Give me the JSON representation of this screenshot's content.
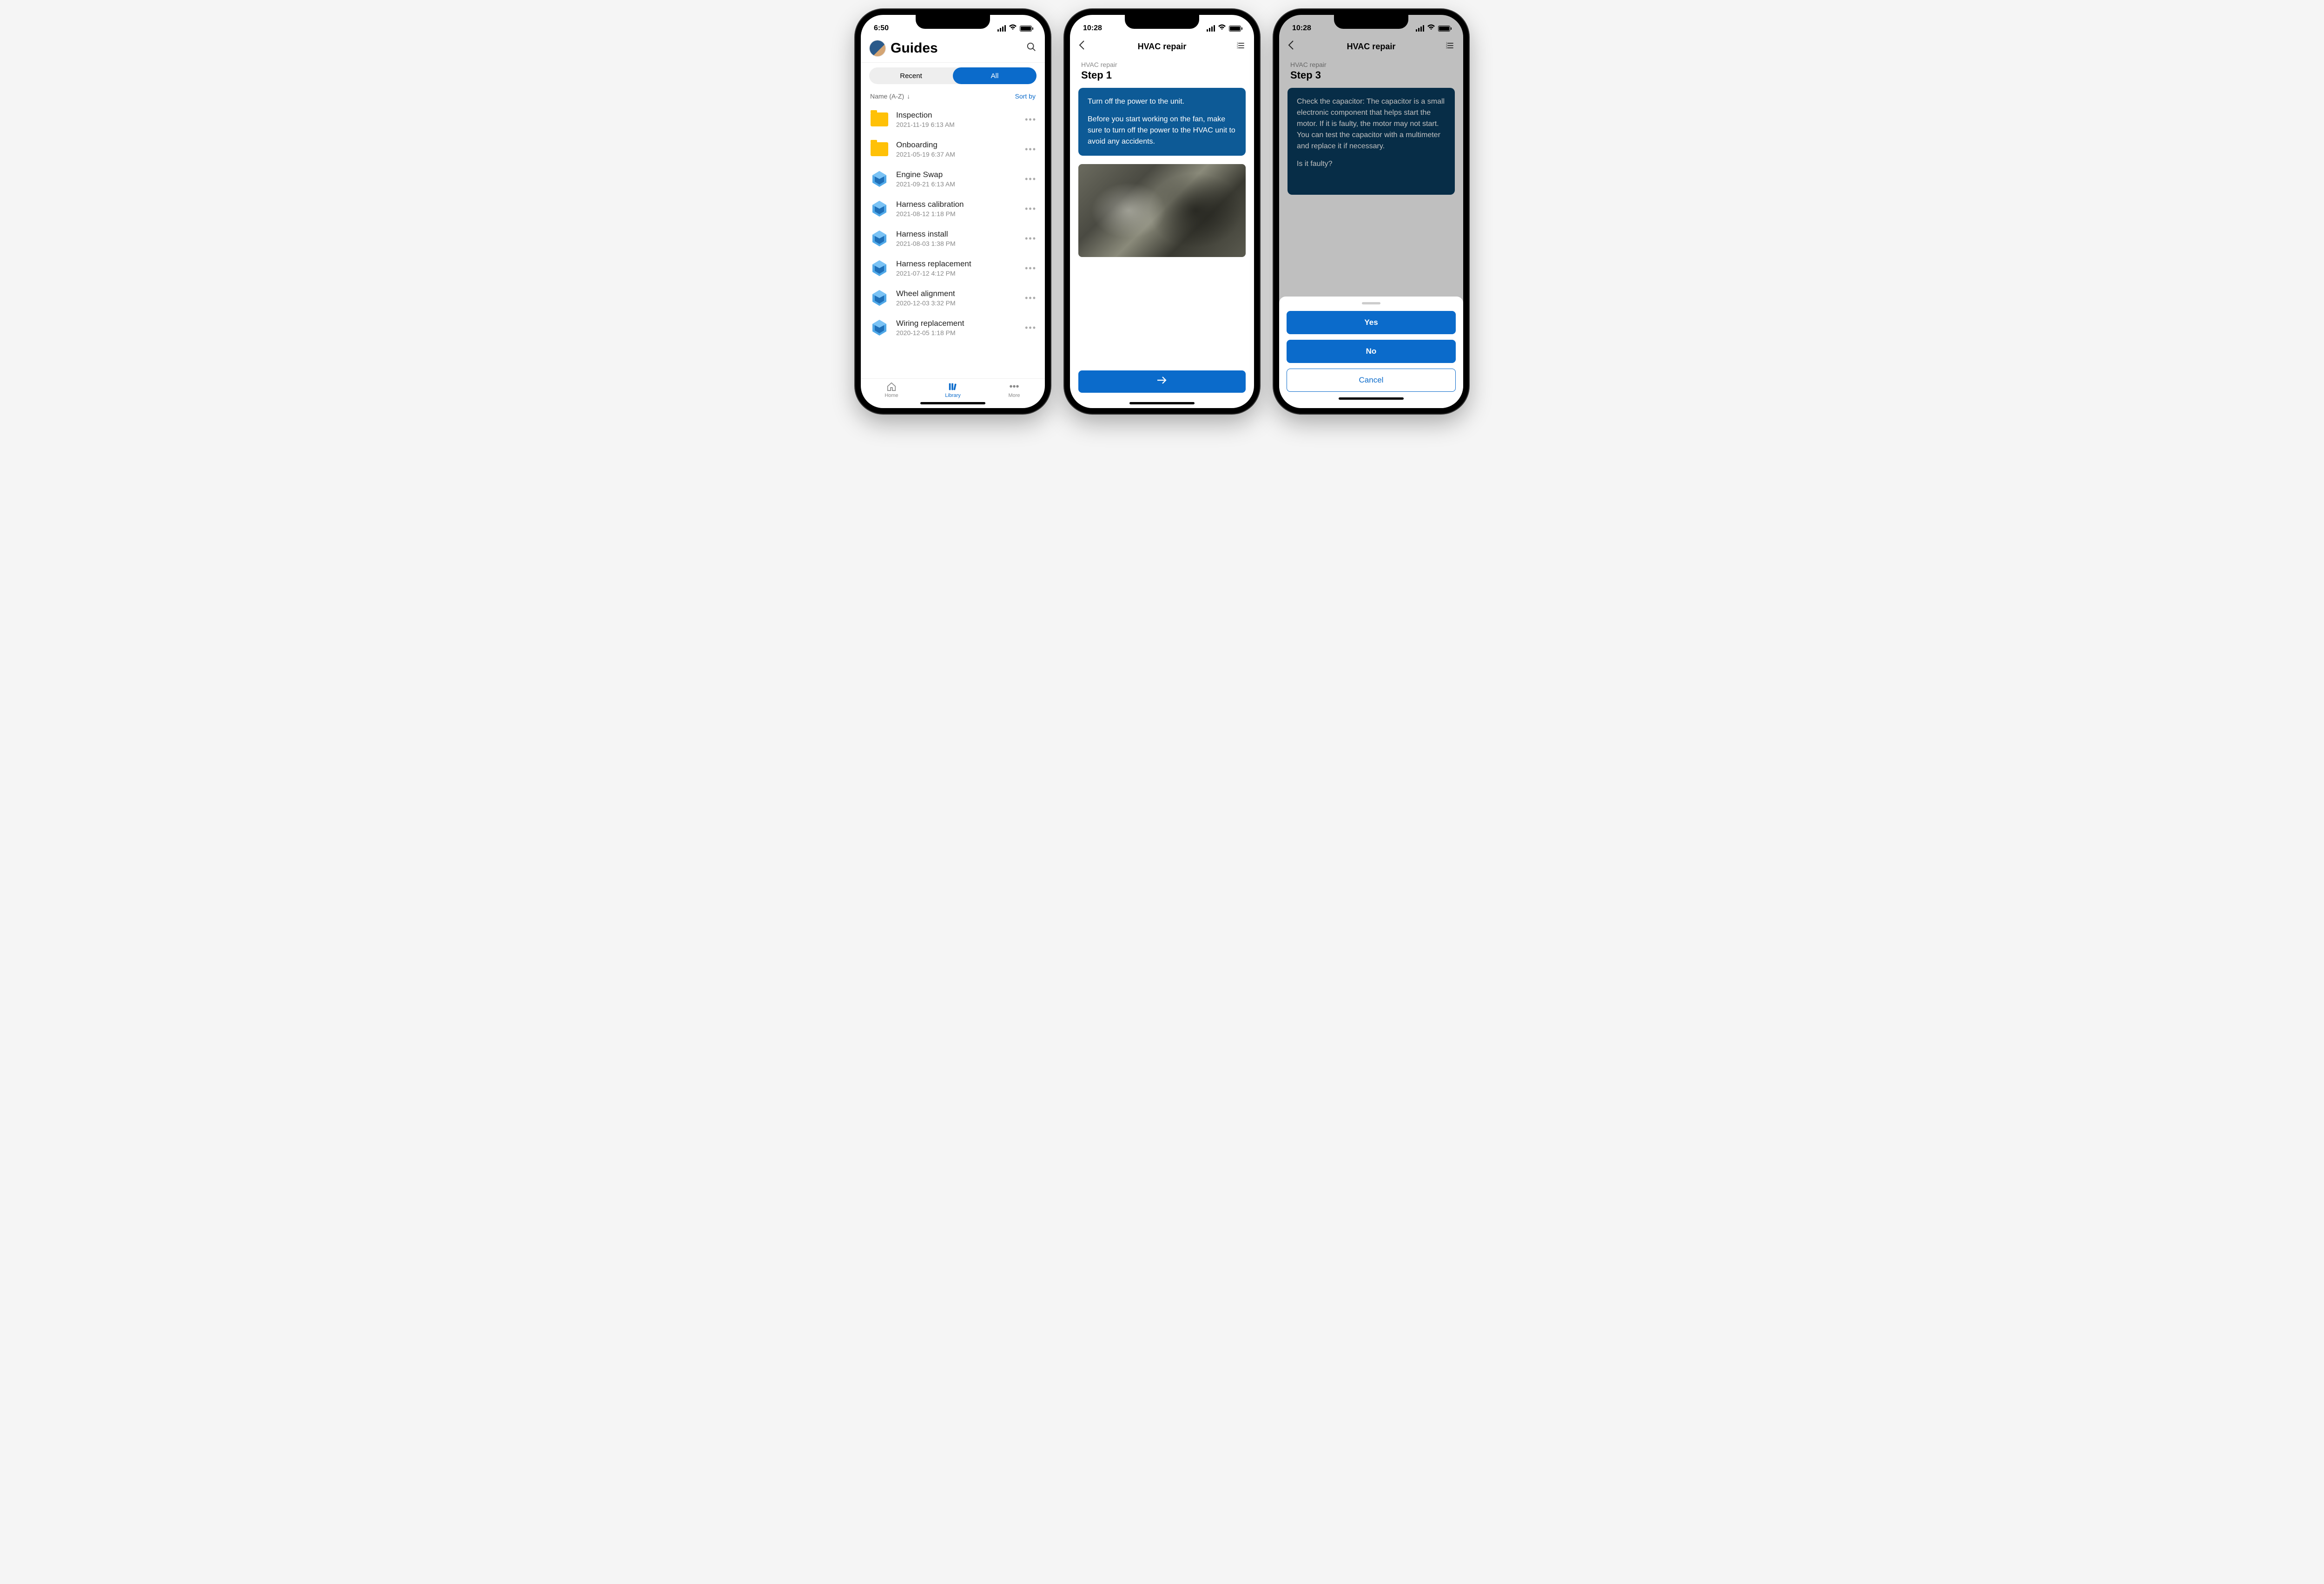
{
  "screen1": {
    "time": "6:50",
    "title": "Guides",
    "tabs": {
      "recent": "Recent",
      "all": "All",
      "active": "all"
    },
    "sort": {
      "label": "Name (A-Z)",
      "sort_by": "Sort by"
    },
    "items": [
      {
        "type": "folder",
        "name": "Inspection",
        "date": "2021-11-19 6:13 AM"
      },
      {
        "type": "folder",
        "name": "Onboarding",
        "date": "2021-05-19 6:37 AM"
      },
      {
        "type": "guide",
        "name": "Engine Swap",
        "date": "2021-09-21 6:13 AM"
      },
      {
        "type": "guide",
        "name": "Harness calibration",
        "date": "2021-08-12 1:18 PM"
      },
      {
        "type": "guide",
        "name": "Harness install",
        "date": "2021-08-03 1:38 PM"
      },
      {
        "type": "guide",
        "name": "Harness replacement",
        "date": "2021-07-12 4:12 PM"
      },
      {
        "type": "guide",
        "name": "Wheel alignment",
        "date": "2020-12-03 3:32 PM"
      },
      {
        "type": "guide",
        "name": "Wiring replacement",
        "date": "2020-12-05 1:18 PM"
      }
    ],
    "tabbar": {
      "home": "Home",
      "library": "Library",
      "more": "More",
      "active": "library"
    }
  },
  "screen2": {
    "time": "10:28",
    "title": "HVAC repair",
    "breadcrumb": "HVAC repair",
    "step": "Step 1",
    "instruction_line1": "Turn off the power to the unit.",
    "instruction_line2": "Before you start working on the fan, make sure to turn off the power to the HVAC unit to avoid any accidents."
  },
  "screen3": {
    "time": "10:28",
    "title": "HVAC repair",
    "breadcrumb": "HVAC repair",
    "step": "Step 3",
    "instruction_line1": "Check the capacitor: The capacitor is a small electronic component that helps start the motor. If it is faulty, the motor may not start. You can test the capacitor with a multimeter and replace it if necessary.",
    "instruction_line2": "Is it faulty?",
    "sheet": {
      "yes": "Yes",
      "no": "No",
      "cancel": "Cancel"
    }
  }
}
